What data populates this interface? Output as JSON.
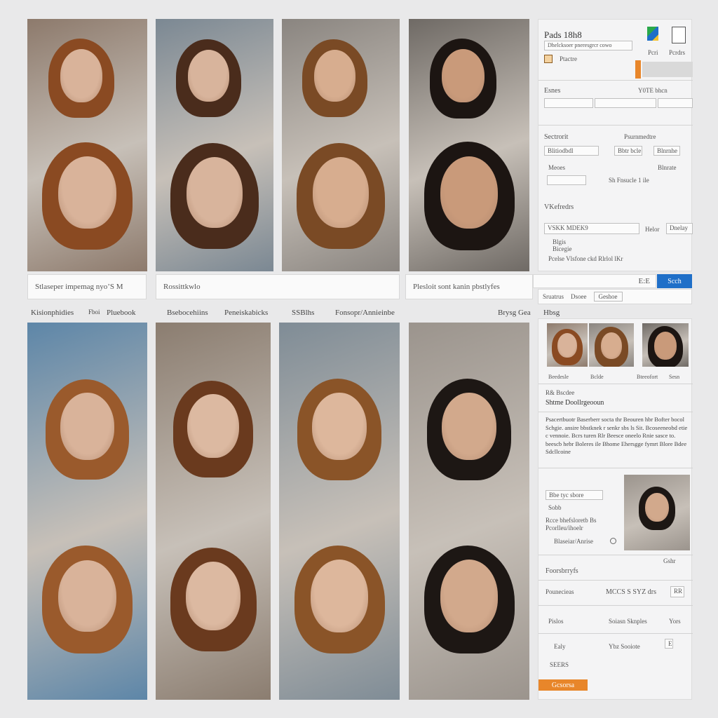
{
  "tiles_top": [
    {
      "name": "gallery-image-1",
      "bg": "#8d7a6c",
      "hair": "#8a4a22",
      "skin": "#d9b39a"
    },
    {
      "name": "gallery-image-2",
      "bg": "#7b8893",
      "hair": "#4a2c1c",
      "skin": "#d8b49c"
    },
    {
      "name": "gallery-image-3",
      "bg": "#8a8580",
      "hair": "#7a4a25",
      "skin": "#d7ad8f"
    },
    {
      "name": "gallery-image-4",
      "bg": "#6f6a65",
      "hair": "#1c1512",
      "skin": "#c99a7a"
    }
  ],
  "tiles_bottom": [
    {
      "name": "gallery-image-5",
      "bg": "#5d86a8",
      "hair": "#9a5a2c",
      "skin": "#d9b39a"
    },
    {
      "name": "gallery-image-6",
      "bg": "#8b7d70",
      "hair": "#6a3a1e",
      "skin": "#dcb9a1"
    },
    {
      "name": "gallery-image-7",
      "bg": "#7f8c96",
      "hair": "#8a5428",
      "skin": "#ddb79c"
    },
    {
      "name": "gallery-image-8",
      "bg": "#9b948d",
      "hair": "#1d1714",
      "skin": "#d2a98c"
    }
  ],
  "captions": {
    "row1_a": "Stlaseper impemag nyo’S M",
    "row1_b": "Rossittkwlo",
    "row1_c": "Plesloit sont kanin pbstlyfes",
    "row2": [
      "Kisionphidies",
      "Fboi",
      "Pluebook",
      "Bsebocehiins",
      "Peneiskabicks",
      "SSBlhs",
      "Fonsopr/Annieinbe",
      "Brysg Gea",
      "Hbsg"
    ]
  },
  "panel_top": {
    "title": "Pads 18h8",
    "subtitle": "Dhelcksoer pneresgrcr cowo",
    "tab1": "Pcri",
    "tab2": "Pcrdrs",
    "row_label": "Ptactre",
    "section1": "Esnes",
    "section1_value": "Y0TE bhcn",
    "section2": "Sectrorit",
    "section2_right": "Psurnmedtre",
    "field_a": "Blitiodbdl",
    "field_b": "Bbtr bcle",
    "field_c": "Blnrnhe",
    "field_d": "Meoes",
    "field_e": "Sh Fnsucle 1 ile",
    "field_f": "Blnrate",
    "section3": "VKefredrs",
    "search_value": "VSKK MDEK9",
    "opt1": "Helor",
    "opt2": "Dnelay",
    "note1": "Blgis",
    "note2": "Bicegie",
    "note3": "Pcelse Vlsfone ckd Rlrlol lKr"
  },
  "search_bar": {
    "value": "E:E",
    "button": "Scch",
    "chip1": "Sruatrus",
    "chip2": "Dsoee",
    "chip3": "Geshoe"
  },
  "panel_bottom": {
    "header": "Hbsg",
    "thumb_labels": [
      "Beedesle",
      "Bclde",
      "Bteeofort",
      "Sesn"
    ],
    "sub1": "R& Bscdee",
    "heading": "Shtme Doollrgeooun",
    "paragraph": "Psacertbuotr Baserberr socta thr Beouren hbr Bofter bocol Schgie. ansire bbstknek r senkr sbs ls Sit. Bcoseeneobd etie c vennoie. Bcrs turen Rlr Beesce oneelo Rnie sasce to. beescb hebr Boleres ile Bhome Ehersgge fymrt Blore Bdee Sdcllcoine",
    "box1": "Bbe tyc sbore",
    "box2": "Sobb",
    "box3": "Rcce bhefsloretb Bs",
    "box4": "Pcorlleu/ihoelr",
    "box5": "Blaseiar/Anrise",
    "portrait_label": "Gshr",
    "sec2": "Foorsbrryfs",
    "row1_l": "Pounecieas",
    "row1_m": "MCCS S  SYZ drs",
    "row1_r": "RR",
    "row2_l": "Pislos",
    "row2_m": "Soiasn Sknples",
    "row2_r": "Yors",
    "row3_l": "Ealy",
    "row3_m": "Ybz Sooiote",
    "row3_r": "E",
    "row4_l": "SEERS",
    "apply": "Gcsorsa"
  }
}
